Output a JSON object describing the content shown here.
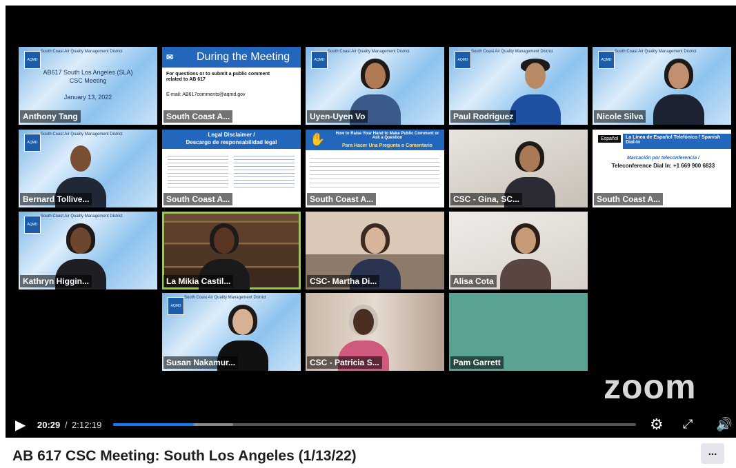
{
  "video": {
    "title": "AB 617 CSC Meeting: South Los Angeles (1/13/22)",
    "brand": "zoom",
    "more_label": "...",
    "current_time": "20:29",
    "separator": "/",
    "duration": "2:12:19",
    "progress": 0.155,
    "buffered": 0.23
  },
  "slides": {
    "org": "South Coast Air Quality Management District",
    "logo_text": "AQMD",
    "title_slide_lines": [
      "AB617 South Los Angeles (SLA)",
      "CSC Meeting"
    ],
    "title_slide_date": "January 13, 2022",
    "during_title": "During the Meeting",
    "during_body": "For questions or to submit a public comment related to AB 617",
    "during_email": "E-mail: AB617comments@aqmd.gov",
    "legal_title_1": "Legal Disclaimer /",
    "legal_title_2": "Descargo de responsabilidad legal",
    "hand_title": "How to Raise Your Hand to Make Public Comment or Ask a Question",
    "hand_title_es": "Para Hacer Una Pregunta o Comentario",
    "espanol_badge": "Español",
    "espanol_title": "La Línea de Español Telefónico / Spanish Dial-In",
    "espanol_sub": "Marcación por teleconferencia /",
    "espanol_dial": "Teleconference Dial In: +1 669 900 6833"
  },
  "participants": [
    "Anthony Tang",
    "South Coast A...",
    "Uyen-Uyen Vo",
    "Paul Rodriguez",
    "Nicole Silva",
    "Bernard Tollive...",
    "South Coast A...",
    "South Coast A...",
    "CSC - Gina, SC...",
    "South Coast A...",
    "Kathryn Higgin...",
    "La Mikia Castil...",
    "CSC- Martha Di...",
    "Alisa Cota",
    "Susan Nakamur...",
    "CSC - Patricia S...",
    "Pam Garrett"
  ],
  "colors": {
    "progress": "#1877f2",
    "active_speaker": "#8bd43b",
    "slide_blue": "#2367bd"
  }
}
